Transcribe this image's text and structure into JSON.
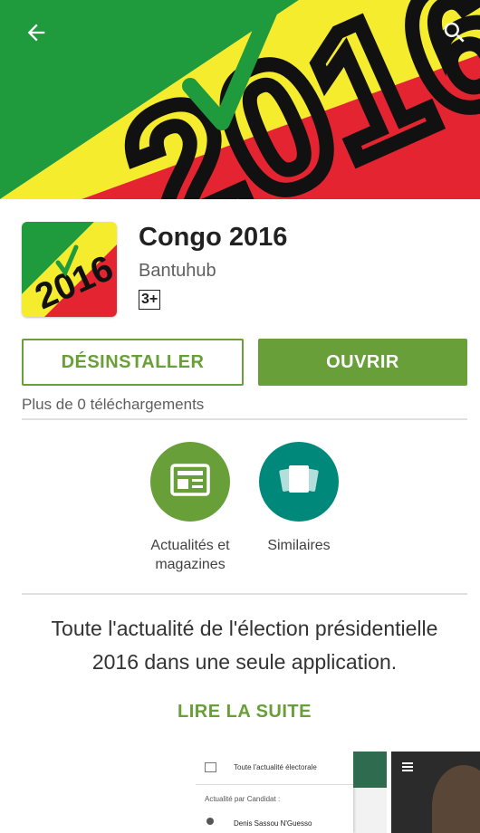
{
  "header": {
    "back_icon": "arrow-back-icon",
    "search_icon": "search-icon"
  },
  "banner": {
    "year_text": "2016"
  },
  "app": {
    "title": "Congo 2016",
    "developer": "Bantuhub",
    "rating": "3+",
    "icon_text": "2016"
  },
  "actions": {
    "uninstall_label": "DÉSINSTALLER",
    "open_label": "OUVRIR"
  },
  "stats": {
    "downloads": "Plus de 0 téléchargements"
  },
  "badges": [
    {
      "label_line1": "Actualités et",
      "label_line2": "magazines",
      "icon": "newspaper-icon",
      "color": "#689f38"
    },
    {
      "label_line1": "Similaires",
      "label_line2": "",
      "icon": "cards-icon",
      "color": "#00897b"
    }
  ],
  "description": {
    "line1": "Toute l'actualité de l'élection présidentielle",
    "line2": "2016 dans une seule application.",
    "read_more": "LIRE LA SUITE"
  },
  "screenshots": {
    "shot1_title": "Toute l'actualité électorale",
    "shot1_section": "Actualité par Candidat :",
    "shot1_item": "Denis Sassou N'Guesso"
  },
  "colors": {
    "accent_green": "#689f38",
    "teal": "#00897b",
    "flag_green": "#1f9a3c",
    "flag_yellow": "#f4ec2c",
    "flag_red": "#e42531"
  }
}
